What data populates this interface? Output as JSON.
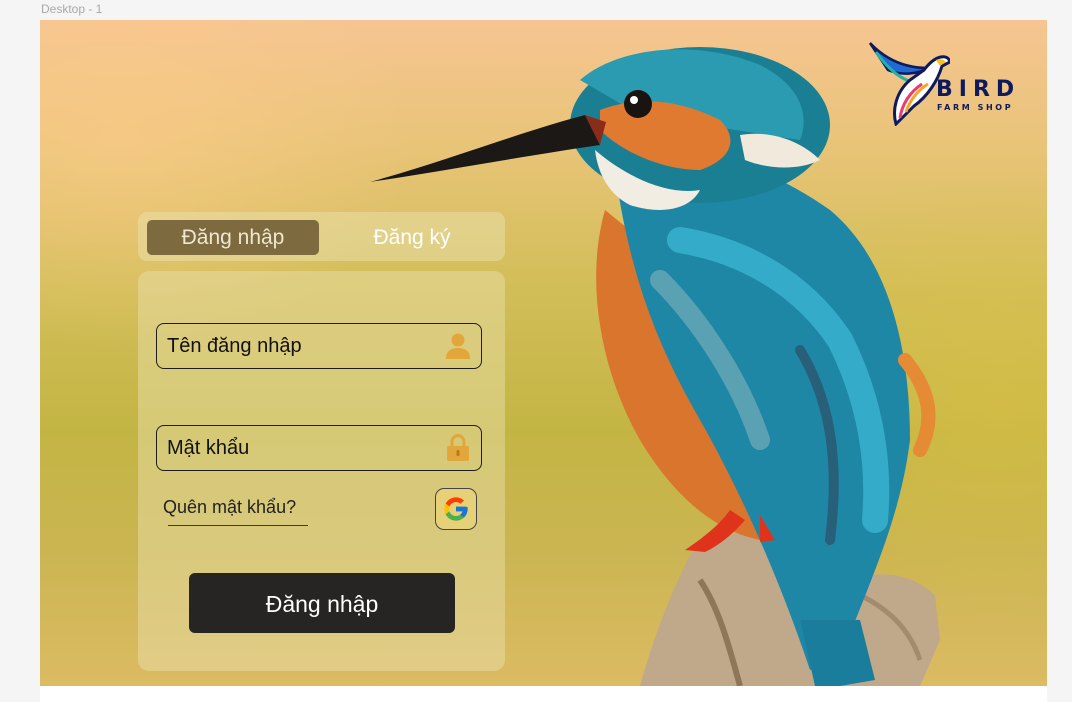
{
  "frame": {
    "label": "Desktop - 1"
  },
  "logo": {
    "title": "BIRD",
    "subtitle": "FARM SHOP"
  },
  "tabs": {
    "login_label": "Đăng nhập",
    "register_label": "Đăng ký",
    "active": "login"
  },
  "form": {
    "username_placeholder": "Tên đăng nhập",
    "password_placeholder": "Mật khẩu",
    "forgot_label": "Quên mật khẩu?",
    "submit_label": "Đăng nhập"
  },
  "icons": {
    "username": "user-icon",
    "password": "lock-icon",
    "google": "google-icon",
    "logo": "bird-logo-icon"
  },
  "colors": {
    "active_tab": "#7d6a3e",
    "submit_button": "#272424",
    "icon_accent": "#e3a63a",
    "logo_navy": "#0e1a5c"
  }
}
